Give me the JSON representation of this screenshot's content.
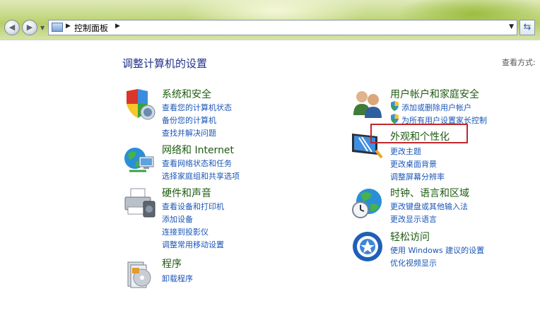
{
  "address": {
    "crumb": "控制面板"
  },
  "page": {
    "title": "调整计算机的设置",
    "view_by": "查看方式:"
  },
  "left": [
    {
      "title": "系统和安全",
      "links": [
        "查看您的计算机状态",
        "备份您的计算机",
        "查找并解决问题"
      ]
    },
    {
      "title": "网络和 Internet",
      "links": [
        "查看网络状态和任务",
        "选择家庭组和共享选项"
      ]
    },
    {
      "title": "硬件和声音",
      "links": [
        "查看设备和打印机",
        "添加设备",
        "连接到投影仪",
        "调整常用移动设置"
      ]
    },
    {
      "title": "程序",
      "links": [
        "卸载程序"
      ]
    }
  ],
  "right": [
    {
      "title": "用户帐户和家庭安全",
      "links": [
        "添加或删除用户帐户",
        "为所有用户设置家长控制"
      ]
    },
    {
      "title": "外观和个性化",
      "links": [
        "更改主题",
        "更改桌面背景",
        "调整屏幕分辨率"
      ]
    },
    {
      "title": "时钟、语言和区域",
      "links": [
        "更改键盘或其他输入法",
        "更改显示语言"
      ]
    },
    {
      "title": "轻松访问",
      "links": [
        "使用 Windows 建议的设置",
        "优化视频显示"
      ]
    }
  ],
  "icons": {
    "back": "back-arrow-icon",
    "forward": "forward-arrow-icon",
    "refresh": "refresh-icon",
    "system_security": "shield-icon",
    "network": "globe-network-icon",
    "hardware": "printer-icon",
    "programs": "programs-box-icon",
    "users": "users-icon",
    "appearance": "display-icon",
    "clock": "globe-clock-icon",
    "ease": "ease-of-access-icon"
  },
  "colors": {
    "category_title": "#1e5b11",
    "link": "#1b56b7",
    "page_title": "#1e3287",
    "highlight_border": "#c0272d"
  }
}
